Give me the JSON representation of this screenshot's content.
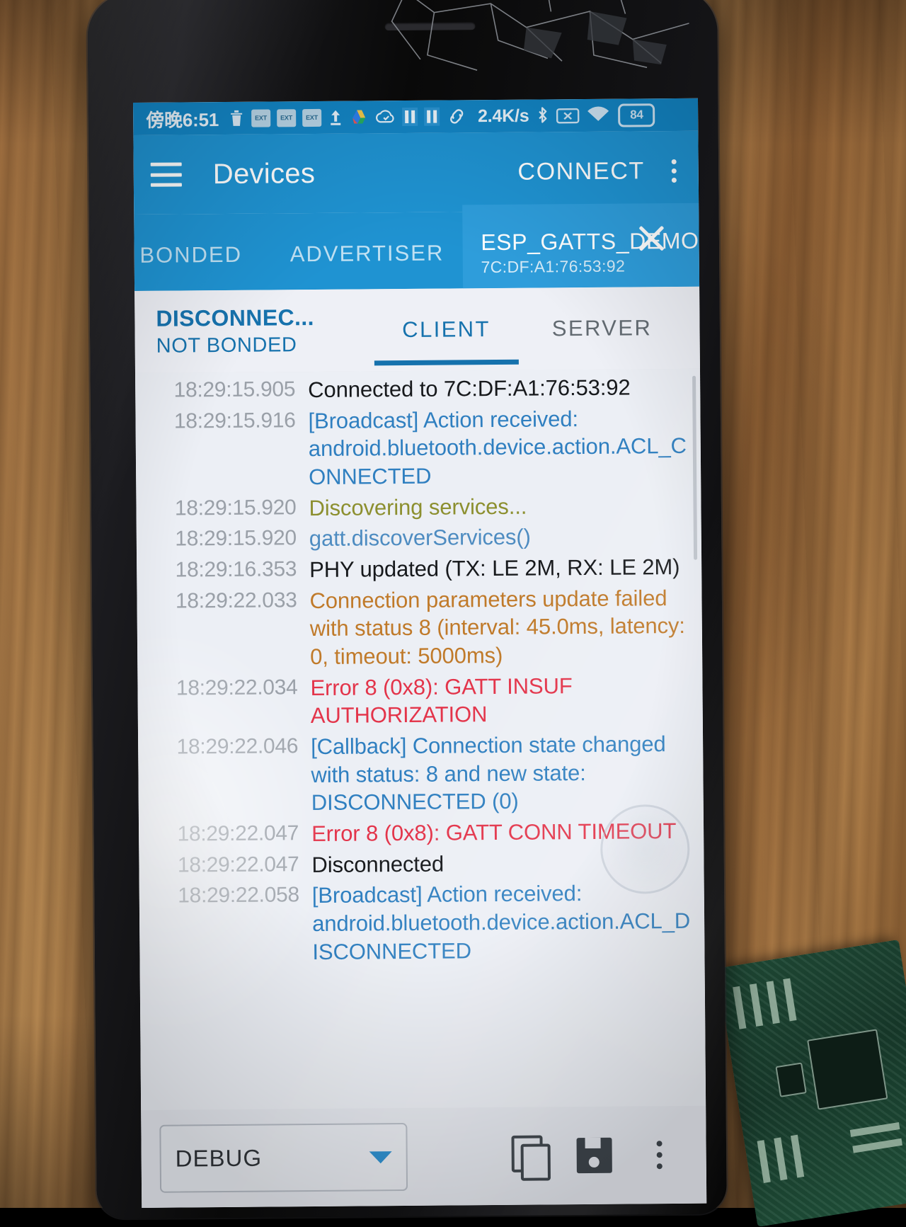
{
  "status_bar": {
    "clock": "傍晚6:51",
    "icons": [
      "trash-icon",
      "ext-badge-1",
      "ext-badge-2",
      "ext-badge-3",
      "upload-icon",
      "drive-icon",
      "cloud-icon",
      "pause-icon-1",
      "pause-icon-2",
      "link-icon",
      "bluetooth-icon",
      "screencast-off-icon",
      "wifi-icon"
    ],
    "badge_text": "EXT",
    "network_speed": "2.4K/s",
    "battery": "84"
  },
  "app_bar": {
    "menu_icon": "hamburger-icon",
    "title": "Devices",
    "connect_label": "CONNECT",
    "overflow_icon": "overflow-menu-icon"
  },
  "device_tabs": [
    {
      "label": "BONDED",
      "selected": false
    },
    {
      "label": "ADVERTISER",
      "selected": false
    }
  ],
  "active_device_tab": {
    "name": "ESP_GATTS_DEMO",
    "address": "7C:DF:A1:76:53:92",
    "close_icon": "close-icon"
  },
  "device_status": {
    "connection": "DISCONNEC...",
    "bond": "NOT BONDED"
  },
  "sub_tabs": [
    {
      "label": "CLIENT",
      "selected": true
    },
    {
      "label": "SERVER",
      "selected": false
    }
  ],
  "log": [
    {
      "time": "18:29:15.905",
      "text": "Connected to 7C:DF:A1:76:53:92",
      "level": "info"
    },
    {
      "time": "18:29:15.916",
      "text": "[Broadcast] Action received: android.bluetooth.device.action.ACL_CONNECTED",
      "level": "debug"
    },
    {
      "time": "18:29:15.920",
      "text": "Discovering services...",
      "level": "app"
    },
    {
      "time": "18:29:15.920",
      "text": "gatt.discoverServices()",
      "level": "verbose"
    },
    {
      "time": "18:29:16.353",
      "text": "PHY updated (TX: LE 2M, RX: LE 2M)",
      "level": "info"
    },
    {
      "time": "18:29:22.033",
      "text": "Connection parameters update failed with status 8 (interval: 45.0ms, latency: 0, timeout: 5000ms)",
      "level": "warn"
    },
    {
      "time": "18:29:22.034",
      "text": "Error 8 (0x8): GATT INSUF AUTHORIZATION",
      "level": "error"
    },
    {
      "time": "18:29:22.046",
      "text": "[Callback] Connection state changed with status: 8 and new state: DISCONNECTED (0)",
      "level": "debug"
    },
    {
      "time": "18:29:22.047",
      "text": "Error 8 (0x8): GATT CONN TIMEOUT",
      "level": "error"
    },
    {
      "time": "18:29:22.047",
      "text": "Disconnected",
      "level": "info"
    },
    {
      "time": "18:29:22.058",
      "text": "[Broadcast] Action received: android.bluetooth.device.action.ACL_DISCONNECTED",
      "level": "debug"
    }
  ],
  "bottom_bar": {
    "log_level": "DEBUG",
    "dropdown_icon": "chevron-down-icon",
    "copy_icon": "copy-icon",
    "save_icon": "save-icon",
    "more_icon": "overflow-menu-icon"
  },
  "colors": {
    "status_bar": "#1386c6",
    "app_bar": "#1f93d2",
    "accent": "#1672ad",
    "error": "#e3344a",
    "warn": "#c07a2a",
    "debug": "#2f7fc0",
    "app_level": "#8c8f2f",
    "screen_bg": "#eceff5"
  }
}
